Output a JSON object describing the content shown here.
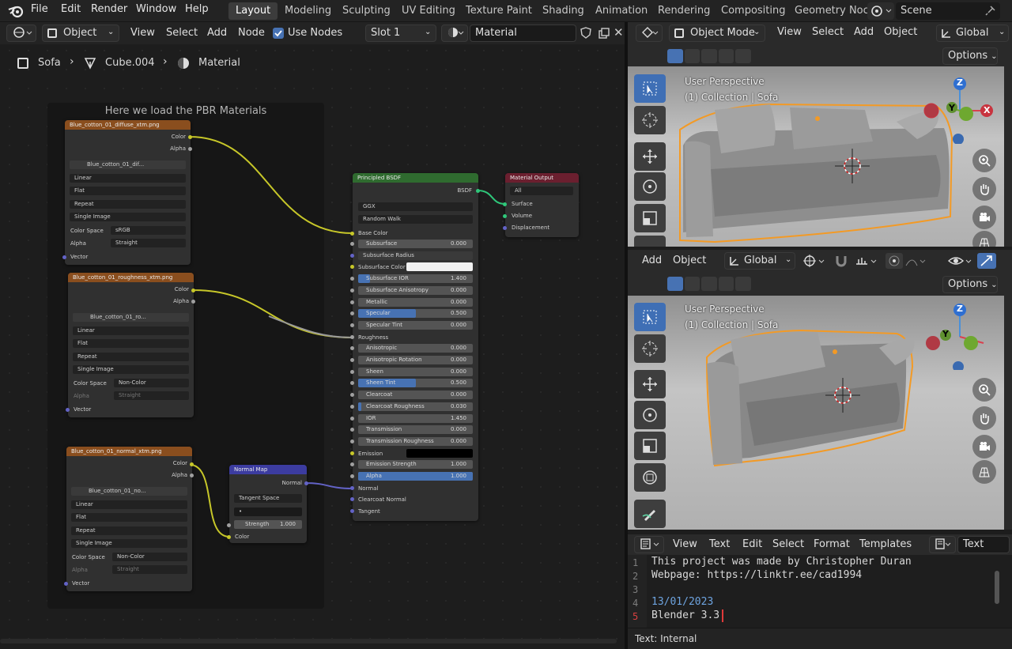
{
  "topbar": {
    "menu": [
      "File",
      "Edit",
      "Render",
      "Window",
      "Help"
    ],
    "workspaces": [
      "Layout",
      "Modeling",
      "Sculpting",
      "UV Editing",
      "Texture Paint",
      "Shading",
      "Animation",
      "Rendering",
      "Compositing",
      "Geometry Noc"
    ],
    "scene": "Scene"
  },
  "node_header": {
    "object_mode": "Object",
    "view": "View",
    "select": "Select",
    "add": "Add",
    "node": "Node",
    "use_nodes": "Use Nodes",
    "slot": "Slot 1",
    "material": "Material"
  },
  "breadcrumb": {
    "object": "Sofa",
    "mesh": "Cube.004",
    "material": "Material"
  },
  "frame": {
    "title": "Here we load the PBR Materials"
  },
  "tex1": {
    "title": "Blue_cotton_01_diffuse_xtm.png",
    "out1": "Color",
    "out2": "Alpha",
    "image": "Blue_cotton_01_dif...",
    "interp": "Linear",
    "proj": "Flat",
    "ext": "Repeat",
    "source": "Single Image",
    "cs_label": "Color Space",
    "cs": "sRGB",
    "alpha_label": "Alpha",
    "alpha": "Straight",
    "vector": "Vector"
  },
  "tex2": {
    "title": "Blue_cotton_01_roughness_xtm.png",
    "out1": "Color",
    "out2": "Alpha",
    "image": "Blue_cotton_01_ro...",
    "interp": "Linear",
    "proj": "Flat",
    "ext": "Repeat",
    "source": "Single Image",
    "cs_label": "Color Space",
    "cs": "Non-Color",
    "alpha_label": "Alpha",
    "alpha": "Straight",
    "vector": "Vector"
  },
  "tex3": {
    "title": "Blue_cotton_01_normal_xtm.png",
    "out1": "Color",
    "out2": "Alpha",
    "image": "Blue_cotton_01_no...",
    "interp": "Linear",
    "proj": "Flat",
    "ext": "Repeat",
    "source": "Single Image",
    "cs_label": "Color Space",
    "cs": "Non-Color",
    "alpha_label": "Alpha",
    "alpha": "Straight",
    "vector": "Vector"
  },
  "normalmap": {
    "title": "Normal Map",
    "out": "Normal",
    "space": "Tangent Space",
    "strength_label": "Strength",
    "strength": "1.000",
    "color": "Color"
  },
  "bsdf": {
    "title": "Principled BSDF",
    "out": "BSDF",
    "dist": "GGX",
    "sss_method": "Random Walk",
    "base_color": "Base Color",
    "rows": [
      {
        "label": "Subsurface",
        "value": "0.000",
        "fill": 0
      },
      {
        "label": "Subsurface Radius",
        "value": "",
        "fill": 0,
        "dropdown": true
      },
      {
        "label": "Subsurface Color",
        "value": "",
        "fill": 0,
        "color": true
      },
      {
        "label": "Subsurface IOR",
        "value": "1.400",
        "fill": 0.1
      },
      {
        "label": "Subsurface Anisotropy",
        "value": "0.000",
        "fill": 0
      },
      {
        "label": "Metallic",
        "value": "0.000",
        "fill": 0
      },
      {
        "label": "Specular",
        "value": "0.500",
        "fill": 0.5
      },
      {
        "label": "Specular Tint",
        "value": "0.000",
        "fill": 0
      },
      {
        "label": "Roughness",
        "value": "",
        "fill": 0,
        "socket_only": true
      },
      {
        "label": "Anisotropic",
        "value": "0.000",
        "fill": 0
      },
      {
        "label": "Anisotropic Rotation",
        "value": "0.000",
        "fill": 0
      },
      {
        "label": "Sheen",
        "value": "0.000",
        "fill": 0
      },
      {
        "label": "Sheen Tint",
        "value": "0.500",
        "fill": 0.5
      },
      {
        "label": "Clearcoat",
        "value": "0.000",
        "fill": 0
      },
      {
        "label": "Clearcoat Roughness",
        "value": "0.030",
        "fill": 0.03
      },
      {
        "label": "IOR",
        "value": "1.450",
        "fill": 0
      },
      {
        "label": "Transmission",
        "value": "0.000",
        "fill": 0
      },
      {
        "label": "Transmission Roughness",
        "value": "0.000",
        "fill": 0
      },
      {
        "label": "Emission",
        "value": "",
        "fill": 0,
        "black": true
      },
      {
        "label": "Emission Strength",
        "value": "1.000",
        "fill": 0
      },
      {
        "label": "Alpha",
        "value": "1.000",
        "fill": 1
      },
      {
        "label": "Normal",
        "value": "",
        "fill": 0,
        "socket_only": true
      },
      {
        "label": "Clearcoat Normal",
        "value": "",
        "fill": 0,
        "socket_only": true
      },
      {
        "label": "Tangent",
        "value": "",
        "fill": 0,
        "socket_only": true
      }
    ]
  },
  "matout": {
    "title": "Material Output",
    "target": "All",
    "surface": "Surface",
    "volume": "Volume",
    "displacement": "Displacement"
  },
  "vp_header": {
    "mode": "Object Mode",
    "view": "View",
    "select": "Select",
    "add": "Add",
    "object": "Object",
    "orientation": "Global",
    "options": "Options"
  },
  "vp1": {
    "persp": "User Perspective",
    "collection": "(1) Collection | Sofa"
  },
  "vp2_header": {
    "add": "Add",
    "object": "Object",
    "orientation": "Global",
    "options": "Options"
  },
  "vp2": {
    "persp": "User Perspective",
    "collection": "(1) Collection | Sofa"
  },
  "gizmo": {
    "z": "Z",
    "y": "Y",
    "x": "X"
  },
  "text_header": {
    "view": "View",
    "text": "Text",
    "edit": "Edit",
    "select": "Select",
    "format": "Format",
    "templates": "Templates",
    "name": "Text"
  },
  "text_lines": [
    {
      "n": "1",
      "t": "This project was made by Christopher Duran"
    },
    {
      "n": "2",
      "t": "Webpage: https://linktr.ee/cad1994"
    },
    {
      "n": "3",
      "t": ""
    },
    {
      "n": "4",
      "t": "13/01/2023"
    },
    {
      "n": "5",
      "t": "Blender 3.3"
    }
  ],
  "text_status": "Text: Internal",
  "colors": {
    "accent": "#4772b3",
    "tex_header": "#8a4e1e",
    "bsdf_header": "#2f6b2f",
    "out_header": "#6b1f2f",
    "vec_header": "#3c3ca0"
  }
}
